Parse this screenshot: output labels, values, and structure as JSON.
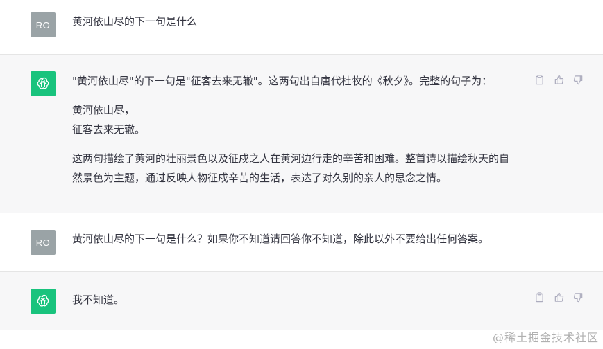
{
  "conversation": [
    {
      "role": "user",
      "avatar_text": "RO",
      "text": "黄河依山尽的下一句是什么"
    },
    {
      "role": "assistant",
      "avatar_icon": "openai-logo-icon",
      "paragraphs": [
        "\"黄河依山尽\"的下一句是\"征客去来无辙\"。这两句出自唐代杜牧的《秋夕》。完整的句子为：",
        "黄河依山尽，\n征客去来无辙。",
        "这两句描绘了黄河的壮丽景色以及征戍之人在黄河边行走的辛苦和困难。整首诗以描绘秋天的自然景色为主题，通过反映人物征戍辛苦的生活，表达了对久别的亲人的思念之情。"
      ]
    },
    {
      "role": "user",
      "avatar_text": "RO",
      "text": "黄河依山尽的下一句是什么？如果你不知道请回答你不知道，除此以外不要给出任何答案。"
    },
    {
      "role": "assistant",
      "avatar_icon": "openai-logo-icon",
      "paragraphs": [
        "我不知道。"
      ]
    }
  ],
  "actions": {
    "icons": [
      "clipboard-icon",
      "thumbs-up-icon",
      "thumbs-down-icon"
    ]
  },
  "colors": {
    "assistant_bg": "#f7f7f8",
    "user_avatar_bg": "#9aa3a6",
    "bot_avatar_bg": "#19c37d",
    "text": "#343541"
  },
  "watermark": "@稀土掘金技术社区"
}
